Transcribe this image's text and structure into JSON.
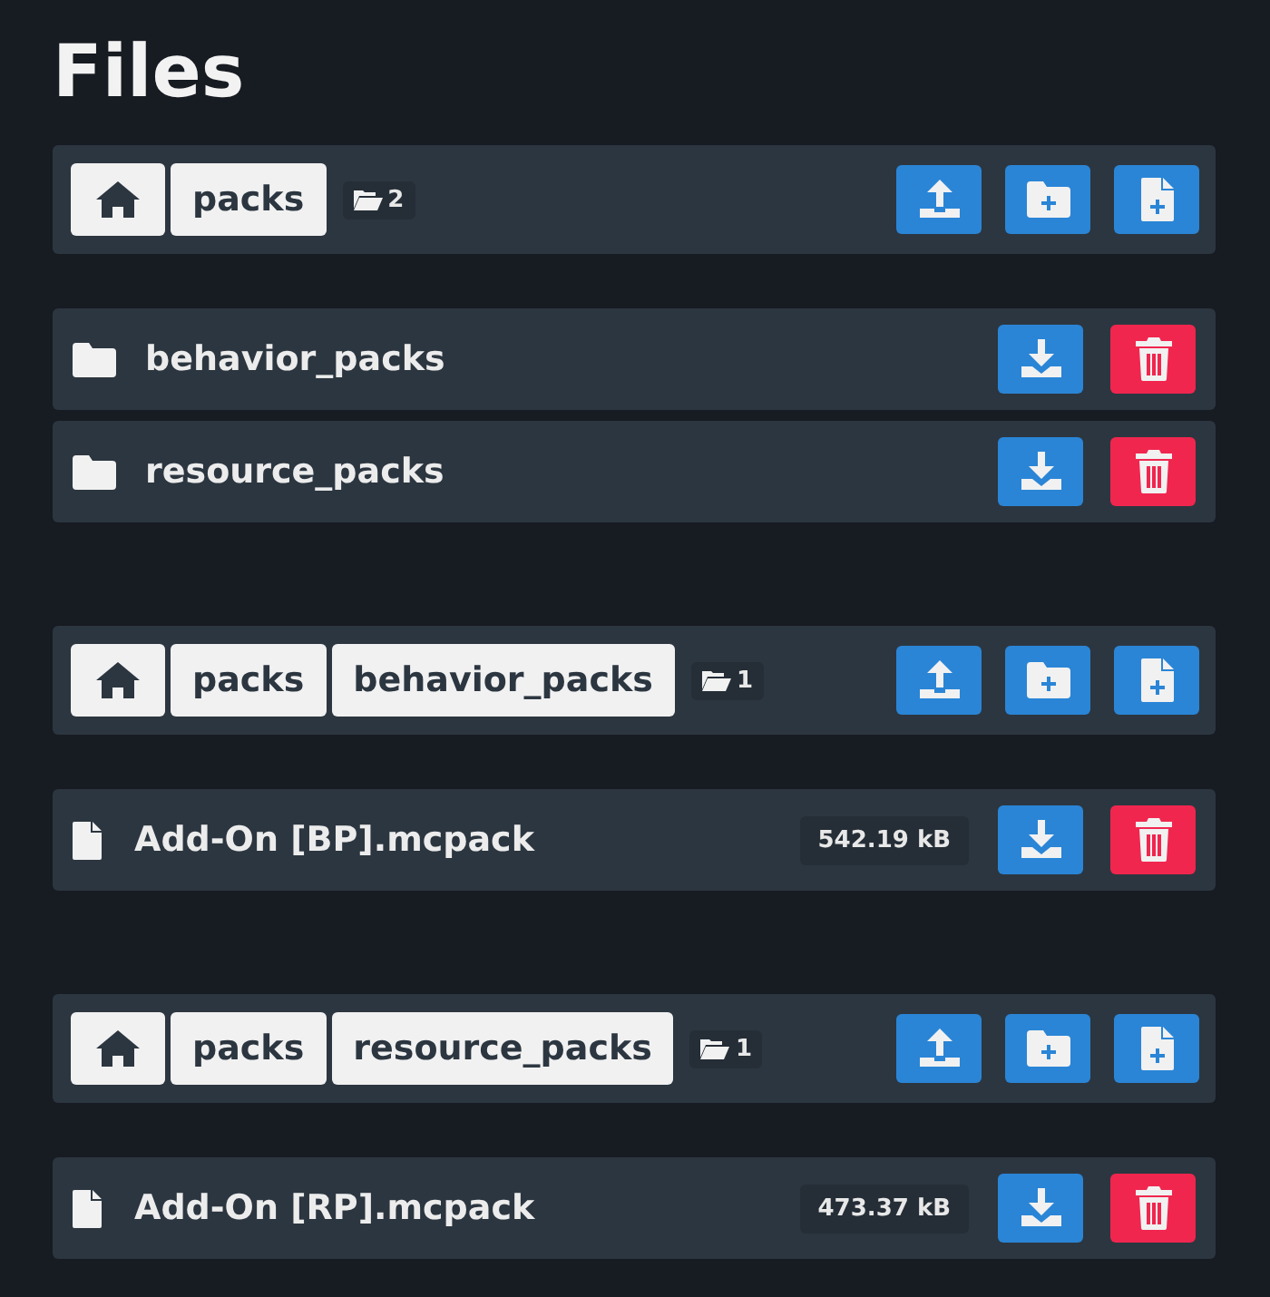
{
  "title": "Files",
  "sections": [
    {
      "breadcrumbs": [
        "packs"
      ],
      "count": "2",
      "entries": [
        {
          "kind": "folder",
          "name": "behavior_packs"
        },
        {
          "kind": "folder",
          "name": "resource_packs"
        }
      ]
    },
    {
      "breadcrumbs": [
        "packs",
        "behavior_packs"
      ],
      "count": "1",
      "entries": [
        {
          "kind": "file",
          "name": "Add-On [BP].mcpack",
          "size": "542.19 kB"
        }
      ]
    },
    {
      "breadcrumbs": [
        "packs",
        "resource_packs"
      ],
      "count": "1",
      "entries": [
        {
          "kind": "file",
          "name": "Add-On [RP].mcpack",
          "size": "473.37 kB"
        }
      ]
    }
  ]
}
